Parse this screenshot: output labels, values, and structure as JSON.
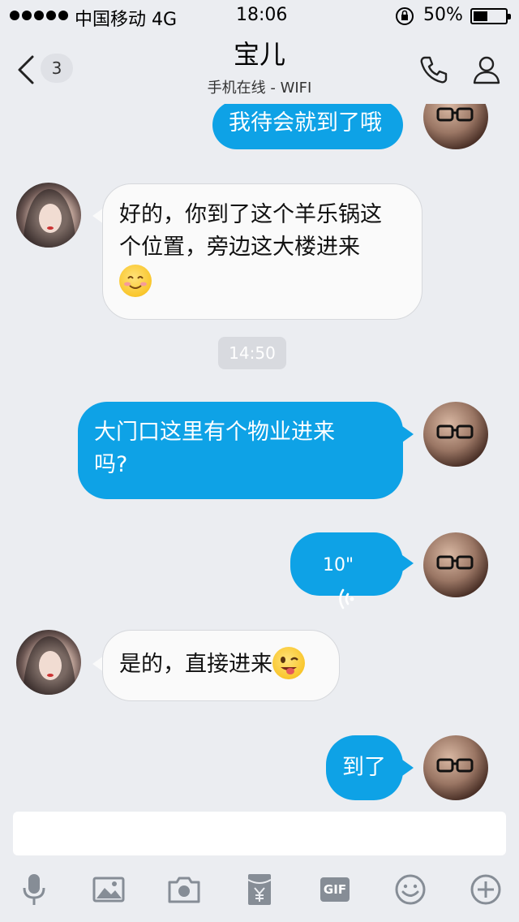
{
  "status_bar": {
    "carrier": "中国移动  4G",
    "time": "18:06",
    "battery_percent": "50%",
    "battery_level": 0.5
  },
  "header": {
    "back_count": "3",
    "contact_name": "宝儿",
    "contact_status": "手机在线 - WIFI"
  },
  "messages": [
    {
      "from": "me",
      "type": "text",
      "text": "我待会就到了哦"
    },
    {
      "from": "contact",
      "type": "text",
      "lines": [
        "好的，你到了这个羊乐锅这",
        "个位置，旁边这大楼进来"
      ],
      "emoji": "smile-emoji"
    },
    {
      "type": "timestamp",
      "text": "14:50"
    },
    {
      "from": "me",
      "type": "text",
      "lines": [
        "大门口这里有个物业进来",
        "吗?"
      ]
    },
    {
      "from": "me",
      "type": "voice",
      "duration": "10\""
    },
    {
      "from": "contact",
      "type": "text",
      "text": "是的，直接进来",
      "emoji": "wink-emoji"
    },
    {
      "from": "me",
      "type": "text",
      "text": "到了"
    }
  ],
  "input": {
    "placeholder": ""
  },
  "toolbar": [
    "microphone-icon",
    "image-icon",
    "camera-icon",
    "red-packet-icon",
    "gif-icon",
    "emoji-icon",
    "plus-icon"
  ],
  "toolbar_gif_label": "GIF",
  "colors": {
    "background": "#ebedf1",
    "outgoing_bubble": "#0ea2e6",
    "incoming_bubble": "#fafafa",
    "icon_gray": "#868d96"
  }
}
